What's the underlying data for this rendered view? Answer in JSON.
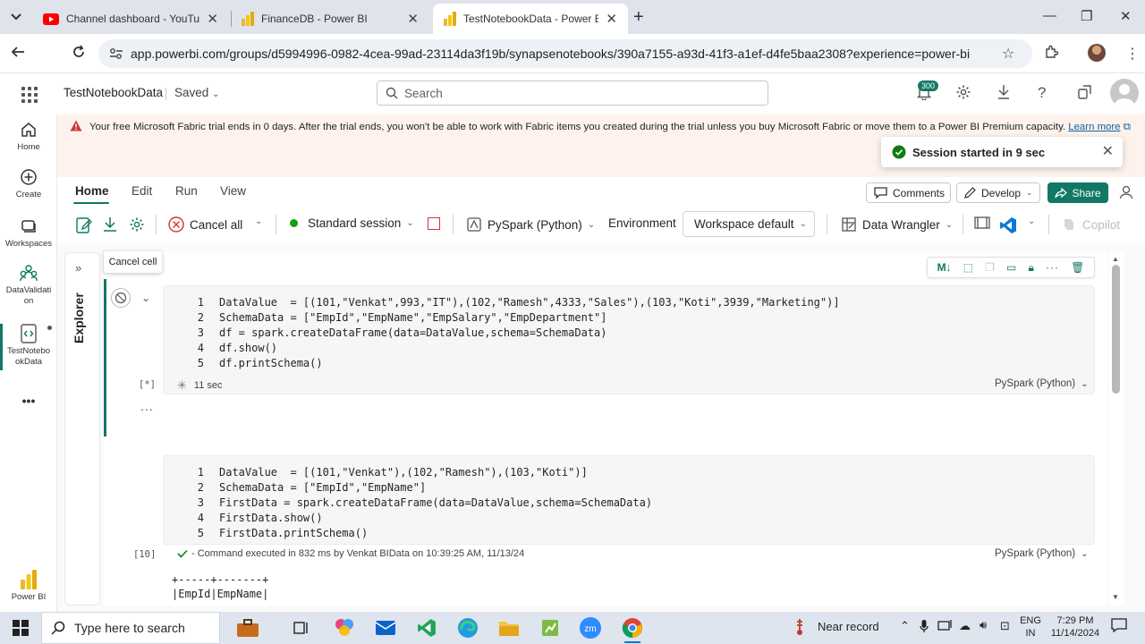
{
  "browser": {
    "tabs": [
      {
        "title": "Channel dashboard - YouTube",
        "icon": "youtube-icon"
      },
      {
        "title": "FinanceDB - Power BI",
        "icon": "powerbi-icon"
      },
      {
        "title": "TestNotebookData - Power BI",
        "icon": "powerbi-icon",
        "active": true
      }
    ],
    "url": "app.powerbi.com/groups/d5994996-0982-4cea-99ad-23114da3f19b/synapsenotebooks/390a7155-a93d-41f3-a1ef-d4fe5baa2308?experience=power-bi"
  },
  "header": {
    "notebook_name": "TestNotebookData",
    "save_state": "Saved",
    "search_placeholder": "Search",
    "notification_count": "300"
  },
  "rail": {
    "items": [
      {
        "label": "Home",
        "icon": "home-icon"
      },
      {
        "label": "Create",
        "icon": "create-icon"
      },
      {
        "label": "Workspaces",
        "icon": "workspaces-icon"
      },
      {
        "label": "DataValidati on",
        "icon": "workspace-people-icon"
      },
      {
        "label": "TestNotebo okData",
        "icon": "notebook-icon"
      },
      {
        "label": "Power BI",
        "icon": "powerbi-icon"
      }
    ]
  },
  "banner": {
    "text": "Your free Microsoft Fabric trial ends in 0 days. After the trial ends, you won't be able to work with Fabric items you created during the trial unless you buy Microsoft Fabric or move them to a Power BI Premium capacity.",
    "link": "Learn more"
  },
  "toast": {
    "text": "Session started in 9 sec"
  },
  "ribbon": {
    "tabs": [
      "Home",
      "Edit",
      "Run",
      "View"
    ],
    "active_tab": "Home",
    "comments": "Comments",
    "develop": "Develop",
    "share": "Share"
  },
  "toolbar": {
    "cancel_all": "Cancel all",
    "session": "Standard session",
    "language": "PySpark (Python)",
    "environment_label": "Environment",
    "environment_value": "Workspace default",
    "data_wrangler": "Data Wrangler",
    "copilot": "Copilot"
  },
  "explorer": {
    "label": "Explorer"
  },
  "tooltip": {
    "text": "Cancel cell"
  },
  "cells": [
    {
      "lines": [
        {
          "n": "1",
          "code": "DataValue  = [(101,\"Venkat\",993,\"IT\"),(102,\"Ramesh\",4333,\"Sales\"),(103,\"Koti\",3939,\"Marketing\")]"
        },
        {
          "n": "2",
          "code": "SchemaData = [\"EmpId\",\"EmpName\",\"EmpSalary\",\"EmpDepartment\"]"
        },
        {
          "n": "3",
          "code": "df = spark.createDataFrame(data=DataValue,schema=SchemaData)"
        },
        {
          "n": "4",
          "code": "df.show()"
        },
        {
          "n": "5",
          "code": "df.printSchema()"
        }
      ],
      "exec_count": "[*]",
      "status": "11 sec",
      "language": "PySpark (Python)"
    },
    {
      "lines": [
        {
          "n": "1",
          "code": "DataValue  = [(101,\"Venkat\"),(102,\"Ramesh\"),(103,\"Koti\")]"
        },
        {
          "n": "2",
          "code": "SchemaData = [\"EmpId\",\"EmpName\"]"
        },
        {
          "n": "3",
          "code": "FirstData = spark.createDataFrame(data=DataValue,schema=SchemaData)"
        },
        {
          "n": "4",
          "code": "FirstData.show()"
        },
        {
          "n": "5",
          "code": "FirstData.printSchema()"
        }
      ],
      "exec_count": "[10]",
      "status": "- Command executed in 832 ms by Venkat BIData on 10:39:25 AM, 11/13/24",
      "language": "PySpark (Python)",
      "output": "+-----+-------+\n|EmpId|EmpName|"
    }
  ],
  "more": "...",
  "taskbar": {
    "search_placeholder": "Type here to search",
    "near_record": "Near record",
    "lang_top": "ENG",
    "lang_bottom": "IN",
    "time": "7:29 PM",
    "date": "11/14/2024"
  },
  "colors": {
    "accent": "#117865",
    "banner_bg": "#fdf3ec",
    "warning": "#d13438"
  }
}
